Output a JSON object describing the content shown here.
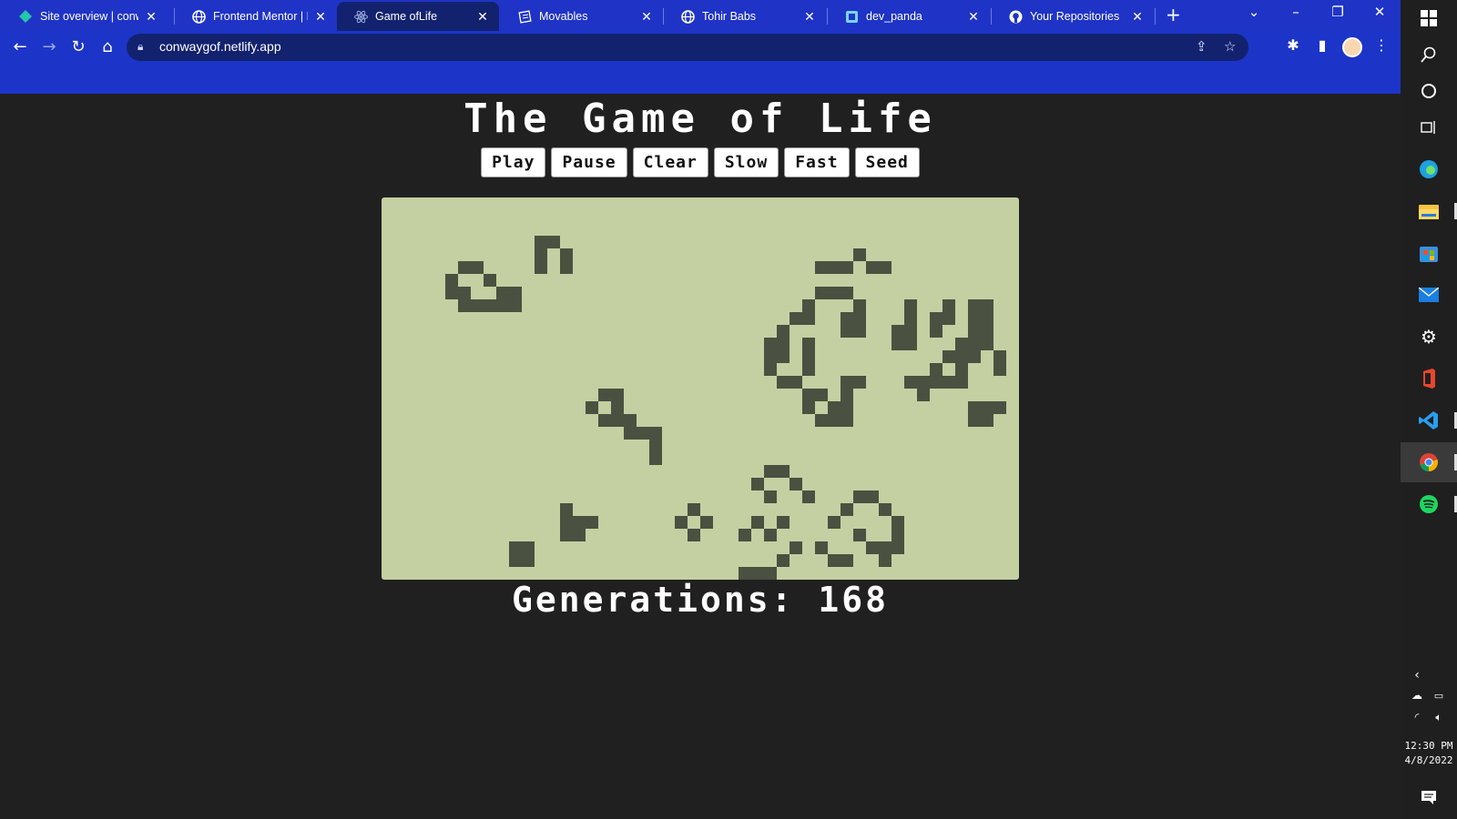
{
  "browser": {
    "tabs": [
      {
        "title": "Site overview | conwa",
        "icon": "netlify-diamond-icon",
        "active": false
      },
      {
        "title": "Frontend Mentor | Ea",
        "icon": "globe-icon",
        "active": false
      },
      {
        "title": "Game ofLife",
        "icon": "react-icon",
        "active": true
      },
      {
        "title": "Movables",
        "icon": "book-icon",
        "active": false
      },
      {
        "title": "Tohir Babs",
        "icon": "globe-icon",
        "active": false
      },
      {
        "title": "dev_panda",
        "icon": "dev-icon",
        "active": false
      },
      {
        "title": "Your Repositories",
        "icon": "github-icon",
        "active": false
      }
    ],
    "url": "conwaygof.netlify.app",
    "accent_color": "#1f34c6"
  },
  "page": {
    "title": "The Game of Life",
    "buttons": [
      "Play",
      "Pause",
      "Clear",
      "Slow",
      "Fast",
      "Seed"
    ],
    "generations_label": "Generations:",
    "generations_value": "168"
  },
  "board": {
    "cols": 50,
    "rows": 30,
    "background": "#c4d0a2",
    "cell_color": "#4a5140",
    "live_cells": [
      [
        12,
        3
      ],
      [
        13,
        3
      ],
      [
        12,
        4
      ],
      [
        14,
        4
      ],
      [
        6,
        5
      ],
      [
        7,
        5
      ],
      [
        5,
        6
      ],
      [
        8,
        6
      ],
      [
        12,
        5
      ],
      [
        14,
        5
      ],
      [
        6,
        5
      ],
      [
        5,
        7
      ],
      [
        9,
        7
      ],
      [
        10,
        7
      ],
      [
        6,
        8
      ],
      [
        7,
        8
      ],
      [
        8,
        8
      ],
      [
        9,
        8
      ],
      [
        10,
        8
      ],
      [
        6,
        7
      ],
      [
        34,
        5
      ],
      [
        35,
        5
      ],
      [
        36,
        5
      ],
      [
        37,
        4
      ],
      [
        38,
        5
      ],
      [
        39,
        5
      ],
      [
        34,
        7
      ],
      [
        35,
        7
      ],
      [
        36,
        7
      ],
      [
        33,
        8
      ],
      [
        37,
        8
      ],
      [
        32,
        9
      ],
      [
        33,
        9
      ],
      [
        36,
        9
      ],
      [
        37,
        9
      ],
      [
        36,
        10
      ],
      [
        37,
        10
      ],
      [
        31,
        10
      ],
      [
        30,
        11
      ],
      [
        31,
        11
      ],
      [
        30,
        12
      ],
      [
        31,
        12
      ],
      [
        30,
        13
      ],
      [
        33,
        11
      ],
      [
        33,
        12
      ],
      [
        33,
        13
      ],
      [
        31,
        14
      ],
      [
        32,
        14
      ],
      [
        33,
        15
      ],
      [
        34,
        15
      ],
      [
        36,
        14
      ],
      [
        37,
        14
      ],
      [
        36,
        15
      ],
      [
        33,
        16
      ],
      [
        35,
        16
      ],
      [
        34,
        17
      ],
      [
        35,
        17
      ],
      [
        36,
        17
      ],
      [
        36,
        16
      ],
      [
        41,
        8
      ],
      [
        44,
        8
      ],
      [
        46,
        8
      ],
      [
        47,
        8
      ],
      [
        41,
        9
      ],
      [
        43,
        9
      ],
      [
        44,
        9
      ],
      [
        46,
        9
      ],
      [
        47,
        9
      ],
      [
        40,
        10
      ],
      [
        41,
        10
      ],
      [
        43,
        10
      ],
      [
        47,
        10
      ],
      [
        46,
        10
      ],
      [
        41,
        11
      ],
      [
        45,
        11
      ],
      [
        46,
        11
      ],
      [
        47,
        11
      ],
      [
        40,
        11
      ],
      [
        44,
        12
      ],
      [
        46,
        12
      ],
      [
        48,
        12
      ],
      [
        43,
        13
      ],
      [
        45,
        12
      ],
      [
        48,
        13
      ],
      [
        41,
        14
      ],
      [
        42,
        14
      ],
      [
        43,
        14
      ],
      [
        44,
        14
      ],
      [
        45,
        14
      ],
      [
        45,
        13
      ],
      [
        42,
        15
      ],
      [
        46,
        16
      ],
      [
        47,
        16
      ],
      [
        48,
        16
      ],
      [
        46,
        17
      ],
      [
        47,
        17
      ],
      [
        17,
        15
      ],
      [
        18,
        15
      ],
      [
        16,
        16
      ],
      [
        18,
        16
      ],
      [
        17,
        17
      ],
      [
        18,
        17
      ],
      [
        19,
        17
      ],
      [
        19,
        18
      ],
      [
        20,
        18
      ],
      [
        21,
        18
      ],
      [
        21,
        19
      ],
      [
        21,
        20
      ],
      [
        30,
        21
      ],
      [
        31,
        21
      ],
      [
        29,
        22
      ],
      [
        32,
        22
      ],
      [
        30,
        23
      ],
      [
        33,
        23
      ],
      [
        37,
        23
      ],
      [
        38,
        23
      ],
      [
        36,
        24
      ],
      [
        39,
        24
      ],
      [
        29,
        25
      ],
      [
        31,
        25
      ],
      [
        35,
        25
      ],
      [
        40,
        25
      ],
      [
        28,
        26
      ],
      [
        30,
        26
      ],
      [
        37,
        26
      ],
      [
        40,
        26
      ],
      [
        32,
        27
      ],
      [
        34,
        27
      ],
      [
        38,
        27
      ],
      [
        39,
        27
      ],
      [
        40,
        27
      ],
      [
        31,
        28
      ],
      [
        35,
        28
      ],
      [
        36,
        28
      ],
      [
        39,
        28
      ],
      [
        28,
        29
      ],
      [
        29,
        29
      ],
      [
        30,
        29
      ],
      [
        14,
        24
      ],
      [
        14,
        25
      ],
      [
        15,
        25
      ],
      [
        16,
        25
      ],
      [
        15,
        26
      ],
      [
        14,
        26
      ],
      [
        24,
        24
      ],
      [
        23,
        25
      ],
      [
        25,
        25
      ],
      [
        24,
        26
      ],
      [
        10,
        27
      ],
      [
        11,
        27
      ],
      [
        10,
        28
      ],
      [
        11,
        28
      ]
    ]
  }
}
